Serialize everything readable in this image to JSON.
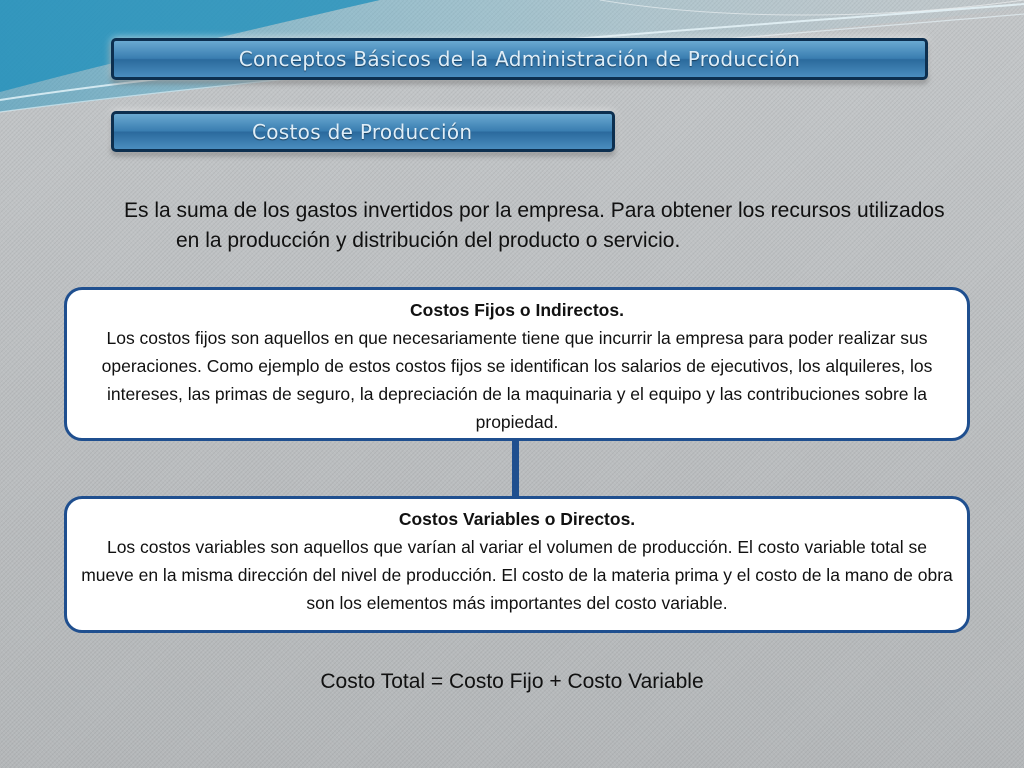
{
  "header": {
    "title": "Conceptos Básicos de la Administración de Producción",
    "subtitle": "Costos de Producción"
  },
  "intro": "Es la suma de los gastos invertidos por la empresa. Para obtener los recursos utilizados en la producción y distribución del producto o servicio.",
  "boxes": {
    "fixed": {
      "title": "Costos Fijos o Indirectos.",
      "text": "Los costos fijos son aquellos en que necesariamente tiene que incurrir la empresa para poder realizar sus operaciones. Como ejemplo de estos costos fijos se identifican los salarios de ejecutivos, los alquileres, los intereses, las primas de seguro, la depreciación de la maquinaria y el equipo y las contribuciones sobre la propiedad."
    },
    "variable": {
      "title": "Costos Variables o Directos.",
      "text": "Los costos variables son aquellos que varían al variar el volumen de producción. El costo variable total se mueve en la misma dirección del nivel de producción. El costo de la materia prima y el costo de la mano de obra son los elementos más importantes del costo variable."
    }
  },
  "formula": "Costo Total = Costo Fijo + Costo Variable",
  "colors": {
    "box_border": "#1f4f8f",
    "title_bar": "#3a7eb1"
  }
}
